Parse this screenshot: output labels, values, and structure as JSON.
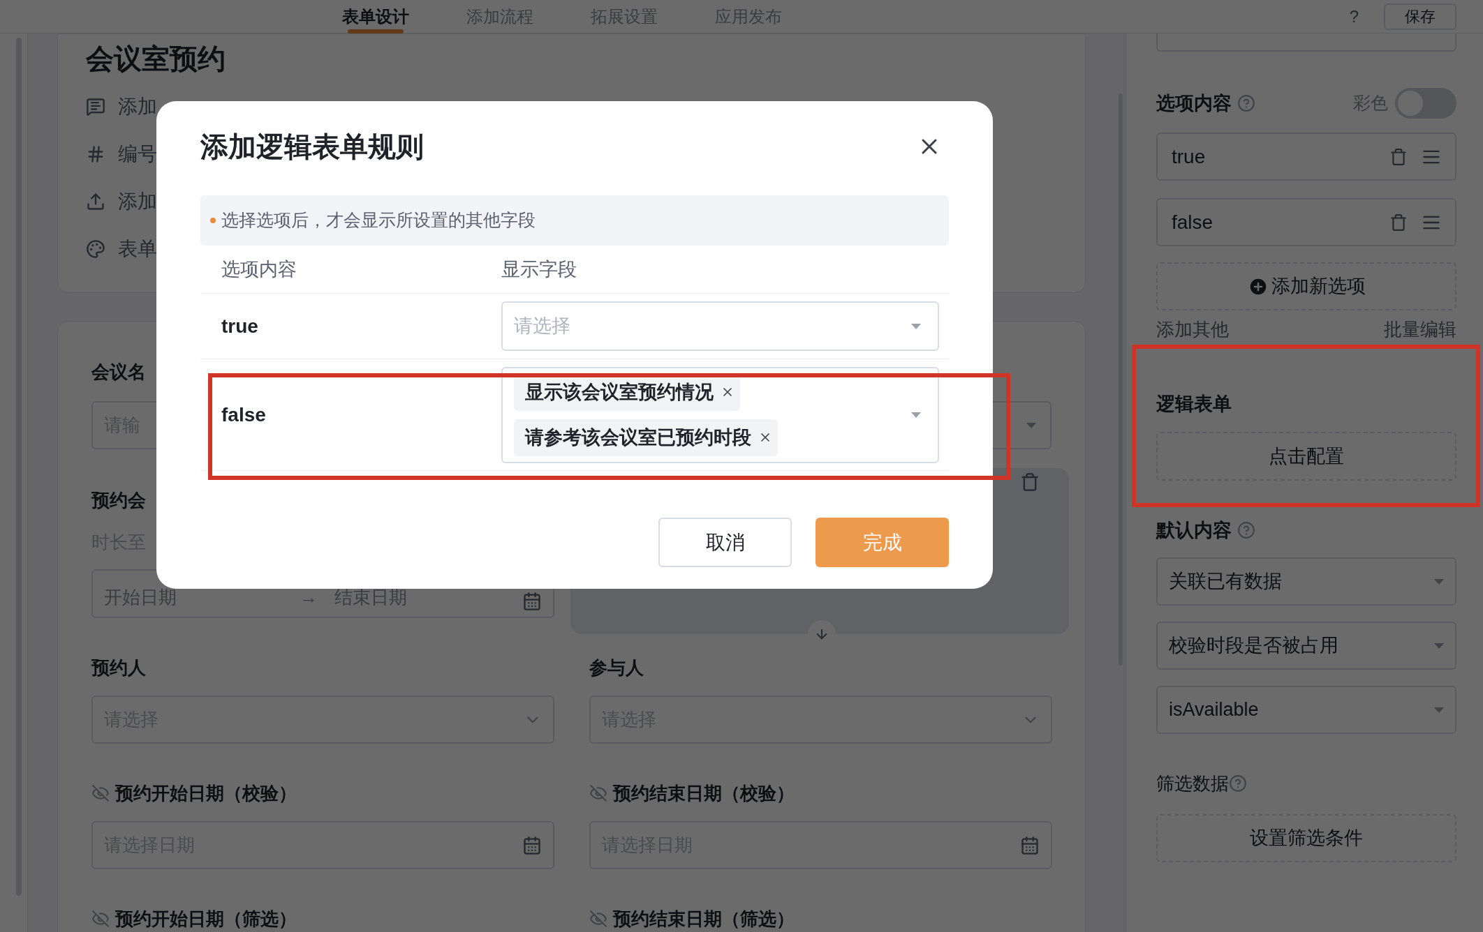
{
  "top_nav": {
    "tabs": [
      {
        "label": "表单设计",
        "selected": true
      },
      {
        "label": "添加流程",
        "selected": false
      },
      {
        "label": "拓展设置",
        "selected": false
      },
      {
        "label": "应用发布",
        "selected": false
      }
    ],
    "help": "?",
    "save": "保存"
  },
  "form_canvas": {
    "title": "会议室预约",
    "actions": [
      "添加",
      "编号",
      "添加",
      "表单"
    ],
    "fields": [
      {
        "label": "会议名",
        "placeholder": "请输"
      },
      {
        "label": "预约会",
        "hint": "时长至",
        "start_placeholder": "开始日期",
        "arrow": "→",
        "end_placeholder": "结束日期"
      },
      {
        "label": "预约人",
        "placeholder": "请选择",
        "hidden": false
      },
      {
        "label": "参与人",
        "placeholder": "请选择",
        "hidden": false
      },
      {
        "label": "预约开始日期（校验）",
        "placeholder": "请选择日期",
        "hidden": true
      },
      {
        "label": "预约结束日期（校验）",
        "placeholder": "请选择日期",
        "hidden": true
      },
      {
        "label": "预约开始日期（筛选）",
        "hidden": true
      },
      {
        "label": "预约结束日期（筛选）",
        "hidden": true
      }
    ]
  },
  "properties": {
    "options_title": "选项内容",
    "colorful_label": "彩色",
    "colorful_on": false,
    "options": [
      "true",
      "false"
    ],
    "add_option": "添加新选项",
    "add_other": "添加其他",
    "batch_edit": "批量编辑",
    "logic_title": "逻辑表单",
    "logic_button": "点击配置",
    "default_title": "默认内容",
    "default_selects": [
      "关联已有数据",
      "校验时段是否被占用",
      "isAvailable"
    ],
    "filter_title": "筛选数据",
    "filter_button": "设置筛选条件"
  },
  "dialog": {
    "title": "添加逻辑表单规则",
    "notice": "选择选项后，才会显示所设置的其他字段",
    "columns": [
      "选项内容",
      "显示字段"
    ],
    "rules": [
      {
        "option": "true",
        "placeholder": "请选择"
      },
      {
        "option": "false",
        "tags": [
          "显示该会议室预约情况",
          "请参考该会议室已预约时段"
        ]
      }
    ],
    "buttons": [
      {
        "label": "取消",
        "kind": "secondary"
      },
      {
        "label": "完成",
        "kind": "primary"
      }
    ]
  }
}
